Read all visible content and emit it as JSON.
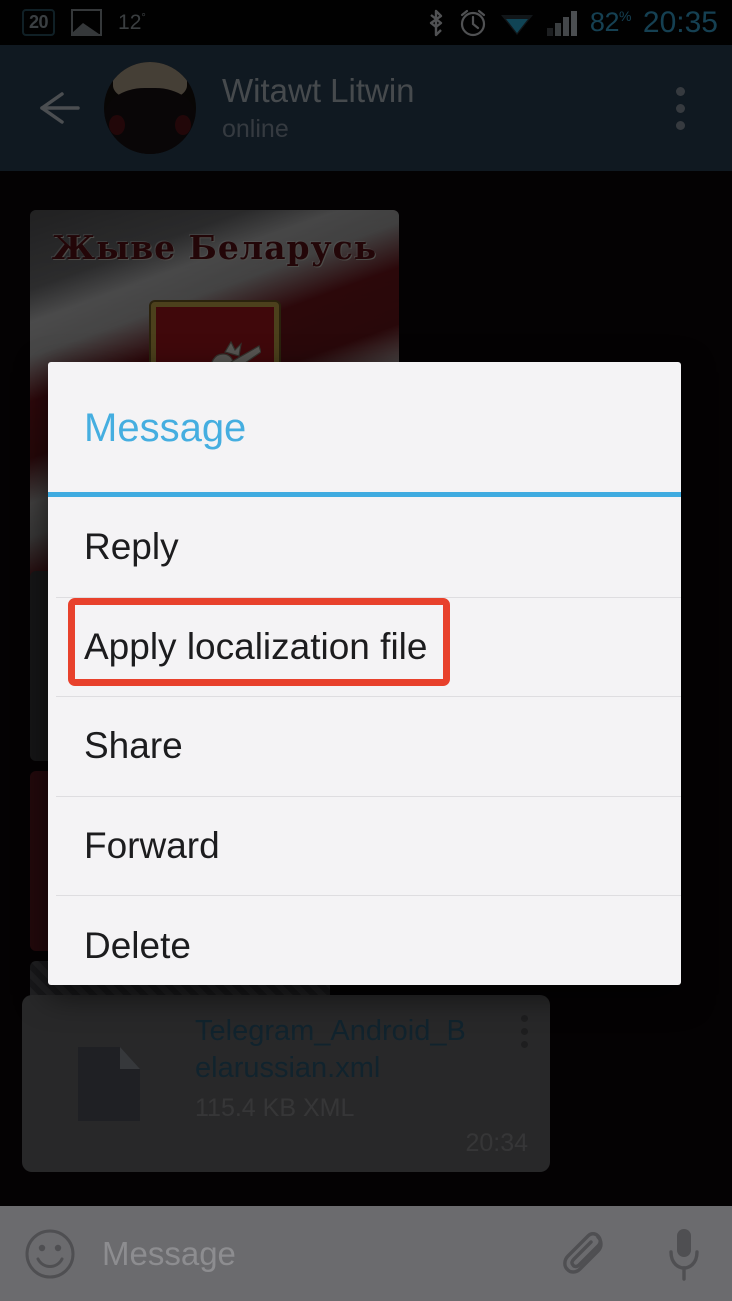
{
  "status_bar": {
    "notification_badge": "20",
    "gallery_icon": "gallery-icon",
    "temperature": "12",
    "degree_symbol": "°",
    "bluetooth_icon": "bluetooth-icon",
    "alarm_icon": "alarm-clock-icon",
    "wifi_icon": "wifi-icon",
    "signal_icon": "cellular-signal-icon",
    "battery_percent": "82",
    "percent_symbol": "%",
    "clock": "20:35",
    "accent_color": "#39a8d8",
    "background_color": "#050505"
  },
  "chat_header": {
    "back_icon": "back-arrow-icon",
    "avatar": "contact-avatar",
    "contact_name": "Witawt Litwin",
    "status": "online",
    "overflow_icon": "more-vertical-icon",
    "background_color": "#2b4258"
  },
  "chat": {
    "photo_message": {
      "caption_text": "Жыве Беларусь",
      "emblem": "pahonia-coat-of-arms"
    },
    "file_message": {
      "icon": "document-icon",
      "file_name": "Telegram_Android_Belarussian.xml",
      "file_size": "115.4 KB XML",
      "time": "20:34",
      "overflow_icon": "more-vertical-icon",
      "name_color": "#2d5d77"
    }
  },
  "dialog": {
    "title": "Message",
    "title_color": "#45aee0",
    "divider_color": "#3fabe0",
    "background_color": "#f4f3f5",
    "items": [
      {
        "label": "Reply",
        "name": "reply"
      },
      {
        "label": "Apply localization file",
        "name": "apply-localization-file",
        "highlighted": true
      },
      {
        "label": "Share",
        "name": "share"
      },
      {
        "label": "Forward",
        "name": "forward"
      },
      {
        "label": "Delete",
        "name": "delete"
      }
    ]
  },
  "annotation": {
    "highlight_color": "#e8412c",
    "target_label": "Apply localization file"
  },
  "input_bar": {
    "emoji_icon": "emoji-smiley-icon",
    "placeholder": "Message",
    "attach_icon": "paperclip-icon",
    "mic_icon": "microphone-icon",
    "background_color": "#6b6b6e"
  }
}
